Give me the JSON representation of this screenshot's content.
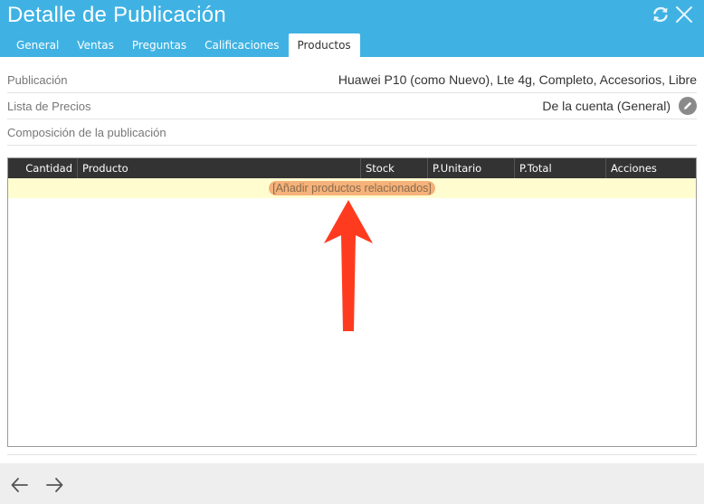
{
  "header": {
    "title": "Detalle de Publicación",
    "icons": {
      "refresh": "refresh-icon",
      "close": "close-icon"
    }
  },
  "tabs": [
    {
      "label": "General",
      "active": false
    },
    {
      "label": "Ventas",
      "active": false
    },
    {
      "label": "Preguntas",
      "active": false
    },
    {
      "label": "Calificaciones",
      "active": false
    },
    {
      "label": "Productos",
      "active": true
    }
  ],
  "fields": {
    "publicacion": {
      "label": "Publicación",
      "value": "Huawei P10 (como Nuevo), Lte 4g, Completo, Accesorios, Libre"
    },
    "lista_precios": {
      "label": "Lista de Precios",
      "value": "De la cuenta (General)"
    },
    "composicion": {
      "label": "Composición de la publicación"
    }
  },
  "table": {
    "columns": [
      "Cantidad",
      "Producto",
      "Stock",
      "P.Unitario",
      "P.Total",
      "Acciones"
    ],
    "add_link": "[Añadir productos relacionados]"
  },
  "footer": {
    "icons": {
      "back": "arrow-left-icon",
      "forward": "arrow-right-icon"
    }
  },
  "colors": {
    "header_bg": "#3fb2e3",
    "table_header_bg": "#333333",
    "add_row_bg": "#fffcd0",
    "highlight": "#f5b27a",
    "annotation_arrow": "#ff3b1f"
  }
}
